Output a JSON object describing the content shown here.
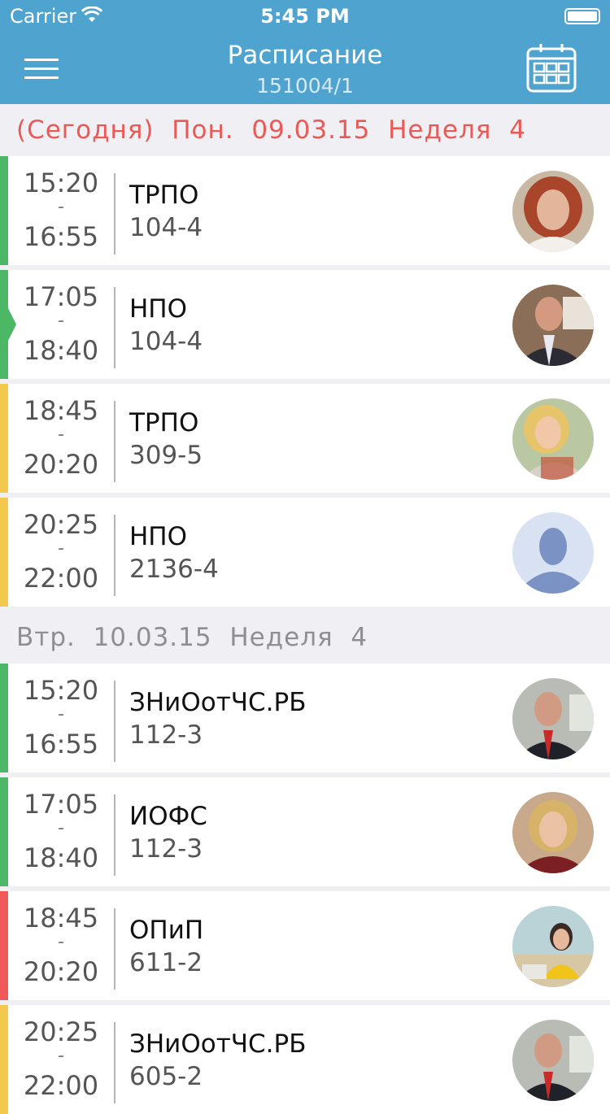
{
  "status_bar": {
    "carrier": "Carrier",
    "time": "5:45 PM"
  },
  "nav": {
    "title": "Расписание",
    "subtitle": "151004/1",
    "menu_icon": "hamburger-menu-icon",
    "calendar_icon": "calendar-icon"
  },
  "colors": {
    "header": "#4fa3cf",
    "green": "#4cb765",
    "yellow": "#f2c94c",
    "red": "#f0585a",
    "today_text": "#e95a57"
  },
  "days": [
    {
      "header": "(Сегодня)  Пон.  09.03.15  Неделя  4",
      "today": true,
      "lessons": [
        {
          "start": "15:20",
          "dash": "-",
          "end": "16:55",
          "subject": "ТРПО",
          "room": "104-4",
          "accent": "green",
          "current": false,
          "avatar": "woman-red"
        },
        {
          "start": "17:05",
          "dash": "-",
          "end": "18:40",
          "subject": "НПО",
          "room": "104-4",
          "accent": "green",
          "current": true,
          "avatar": "man-suit"
        },
        {
          "start": "18:45",
          "dash": "-",
          "end": "20:20",
          "subject": "ТРПО",
          "room": "309-5",
          "accent": "yellow",
          "current": false,
          "avatar": "woman-blonde"
        },
        {
          "start": "20:25",
          "dash": "-",
          "end": "22:00",
          "subject": "НПО",
          "room": "2136-4",
          "accent": "yellow",
          "current": false,
          "avatar": "placeholder"
        }
      ]
    },
    {
      "header": "Втр.  10.03.15  Неделя  4",
      "today": false,
      "lessons": [
        {
          "start": "15:20",
          "dash": "-",
          "end": "16:55",
          "subject": "ЗНиОотЧС.РБ",
          "room": "112-3",
          "accent": "green",
          "current": false,
          "avatar": "man-office"
        },
        {
          "start": "17:05",
          "dash": "-",
          "end": "18:40",
          "subject": "ИОФС",
          "room": "112-3",
          "accent": "green",
          "current": false,
          "avatar": "woman-darkred"
        },
        {
          "start": "18:45",
          "dash": "-",
          "end": "20:20",
          "subject": "ОПиП",
          "room": "611-2",
          "accent": "red",
          "current": false,
          "avatar": "woman-desk"
        },
        {
          "start": "20:25",
          "dash": "-",
          "end": "22:00",
          "subject": "ЗНиОотЧС.РБ",
          "room": "605-2",
          "accent": "yellow",
          "current": false,
          "avatar": "man-office"
        }
      ]
    }
  ]
}
